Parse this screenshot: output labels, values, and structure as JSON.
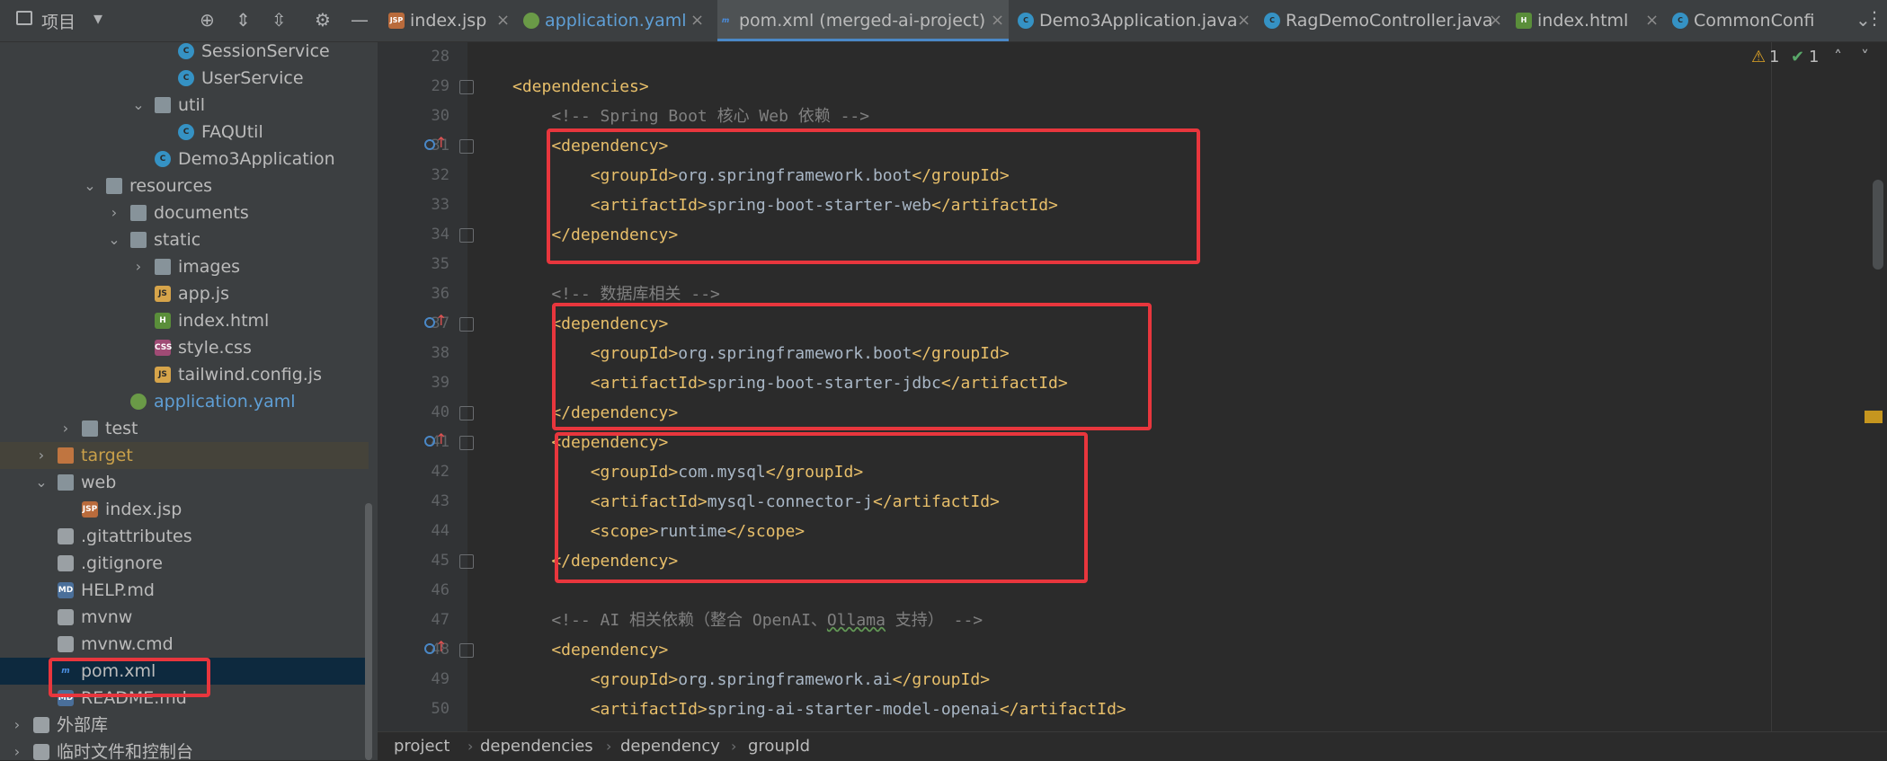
{
  "sidebar": {
    "header_label": "项目",
    "tree": [
      {
        "label": "SessionService",
        "icon": "class-icon",
        "kind": "class"
      },
      {
        "label": "UserService",
        "icon": "class-icon",
        "kind": "class"
      },
      {
        "label": "util",
        "icon": "package-icon",
        "kind": "folder"
      },
      {
        "label": "FAQUtil",
        "icon": "class-icon",
        "kind": "class"
      },
      {
        "label": "Demo3Application",
        "icon": "spring-class-icon",
        "kind": "class"
      },
      {
        "label": "resources",
        "icon": "folder-icon",
        "kind": "folder"
      },
      {
        "label": "documents",
        "icon": "folder-icon",
        "kind": "folder"
      },
      {
        "label": "static",
        "icon": "folder-icon",
        "kind": "folder"
      },
      {
        "label": "images",
        "icon": "folder-icon",
        "kind": "folder"
      },
      {
        "label": "app.js",
        "icon": "js-file-icon",
        "kind": "file"
      },
      {
        "label": "index.html",
        "icon": "html-file-icon",
        "kind": "file"
      },
      {
        "label": "style.css",
        "icon": "css-file-icon",
        "kind": "file"
      },
      {
        "label": "tailwind.config.js",
        "icon": "js-file-icon",
        "kind": "file"
      },
      {
        "label": "application.yaml",
        "icon": "yaml-file-icon",
        "kind": "file"
      },
      {
        "label": "test",
        "icon": "folder-icon",
        "kind": "folder"
      },
      {
        "label": "target",
        "icon": "folder-icon",
        "kind": "folder"
      },
      {
        "label": "web",
        "icon": "folder-icon",
        "kind": "folder"
      },
      {
        "label": "index.jsp",
        "icon": "jsp-file-icon",
        "kind": "file"
      },
      {
        "label": ".gitattributes",
        "icon": "file-icon",
        "kind": "file"
      },
      {
        "label": ".gitignore",
        "icon": "file-icon",
        "kind": "file"
      },
      {
        "label": "HELP.md",
        "icon": "md-file-icon",
        "kind": "file"
      },
      {
        "label": "mvnw",
        "icon": "file-icon",
        "kind": "file"
      },
      {
        "label": "mvnw.cmd",
        "icon": "file-icon",
        "kind": "file"
      },
      {
        "label": "pom.xml",
        "icon": "maven-icon",
        "kind": "file"
      },
      {
        "label": "README.md",
        "icon": "md-file-icon",
        "kind": "file"
      },
      {
        "label": "外部库",
        "icon": "library-icon",
        "kind": "folder"
      },
      {
        "label": "临时文件和控制台",
        "icon": "scratch-icon",
        "kind": "folder"
      }
    ]
  },
  "tabs": [
    {
      "label": "index.jsp",
      "icon": "jsp-file-icon"
    },
    {
      "label": "application.yaml",
      "icon": "yaml-file-icon"
    },
    {
      "label": "pom.xml (merged-ai-project)",
      "icon": "maven-icon"
    },
    {
      "label": "Demo3Application.java",
      "icon": "spring-class-icon"
    },
    {
      "label": "RagDemoController.java",
      "icon": "class-icon"
    },
    {
      "label": "index.html",
      "icon": "html-file-icon"
    },
    {
      "label": "CommonConfi",
      "icon": "class-icon"
    }
  ],
  "inspections": {
    "warnings": "1",
    "ok": "1"
  },
  "editor": {
    "lines": [
      {
        "n": "28",
        "parts": []
      },
      {
        "n": "29",
        "parts": [
          {
            "c": "tag",
            "t": "<dependencies>"
          }
        ]
      },
      {
        "n": "30",
        "parts": [
          {
            "c": "cmt",
            "t": "    <!-- Spring Boot 核心 Web 依赖 -->"
          }
        ]
      },
      {
        "n": "31",
        "parts": [
          {
            "c": "tag",
            "t": "    <dependency>"
          }
        ]
      },
      {
        "n": "32",
        "parts": [
          {
            "c": "tag",
            "t": "        <groupId>"
          },
          {
            "c": "txt",
            "t": "org.springframework.boot"
          },
          {
            "c": "tag",
            "t": "</groupId>"
          }
        ]
      },
      {
        "n": "33",
        "parts": [
          {
            "c": "tag",
            "t": "        <artifactId>"
          },
          {
            "c": "txt",
            "t": "spring-boot-starter-web"
          },
          {
            "c": "tag",
            "t": "</artifactId>"
          }
        ]
      },
      {
        "n": "34",
        "parts": [
          {
            "c": "tag",
            "t": "    </dependency>"
          }
        ]
      },
      {
        "n": "35",
        "parts": []
      },
      {
        "n": "36",
        "parts": [
          {
            "c": "cmt",
            "t": "    <!-- 数据库相关 -->"
          }
        ]
      },
      {
        "n": "37",
        "parts": [
          {
            "c": "tag",
            "t": "    <dependency>"
          }
        ]
      },
      {
        "n": "38",
        "parts": [
          {
            "c": "tag",
            "t": "        <groupId>"
          },
          {
            "c": "txt",
            "t": "org.springframework.boot"
          },
          {
            "c": "tag",
            "t": "</groupId>"
          }
        ]
      },
      {
        "n": "39",
        "parts": [
          {
            "c": "tag",
            "t": "        <artifactId>"
          },
          {
            "c": "txt",
            "t": "spring-boot-starter-jdbc"
          },
          {
            "c": "tag",
            "t": "</artifactId>"
          }
        ]
      },
      {
        "n": "40",
        "parts": [
          {
            "c": "tag",
            "t": "    </dependency>"
          }
        ]
      },
      {
        "n": "41",
        "parts": [
          {
            "c": "tag",
            "t": "    <dependency>"
          }
        ]
      },
      {
        "n": "42",
        "parts": [
          {
            "c": "tag",
            "t": "        <groupId>"
          },
          {
            "c": "txt",
            "t": "com.mysql"
          },
          {
            "c": "tag",
            "t": "</groupId>"
          }
        ]
      },
      {
        "n": "43",
        "parts": [
          {
            "c": "tag",
            "t": "        <artifactId>"
          },
          {
            "c": "txt",
            "t": "mysql-connector-j"
          },
          {
            "c": "tag",
            "t": "</artifactId>"
          }
        ]
      },
      {
        "n": "44",
        "parts": [
          {
            "c": "tag",
            "t": "        <scope>"
          },
          {
            "c": "txt",
            "t": "runtime"
          },
          {
            "c": "tag",
            "t": "</scope>"
          }
        ]
      },
      {
        "n": "45",
        "parts": [
          {
            "c": "tag",
            "t": "    </dependency>"
          }
        ]
      },
      {
        "n": "46",
        "parts": []
      },
      {
        "n": "47",
        "parts": [
          {
            "c": "cmt",
            "t": "    <!-- AI 相关依赖（整合 OpenAI、"
          },
          {
            "c": "cmt squig",
            "t": "Ollama"
          },
          {
            "c": "cmt",
            "t": " 支持） -->"
          }
        ]
      },
      {
        "n": "48",
        "parts": [
          {
            "c": "tag",
            "t": "    <dependency>"
          }
        ]
      },
      {
        "n": "49",
        "parts": [
          {
            "c": "tag",
            "t": "        <groupId>"
          },
          {
            "c": "txt",
            "t": "org.springframework.ai"
          },
          {
            "c": "tag",
            "t": "</groupId>"
          }
        ]
      },
      {
        "n": "50",
        "parts": [
          {
            "c": "tag",
            "t": "        <artifactId>"
          },
          {
            "c": "txt",
            "t": "spring-ai-starter-model-openai"
          },
          {
            "c": "tag",
            "t": "</artifactId>"
          }
        ]
      }
    ]
  },
  "breadcrumb": [
    "project",
    "dependencies",
    "dependency",
    "groupId"
  ],
  "colors": {
    "accent": "#4a88c7",
    "highlight_box": "#e8363d",
    "tag": "#e8bf6a",
    "comment": "#808080"
  }
}
